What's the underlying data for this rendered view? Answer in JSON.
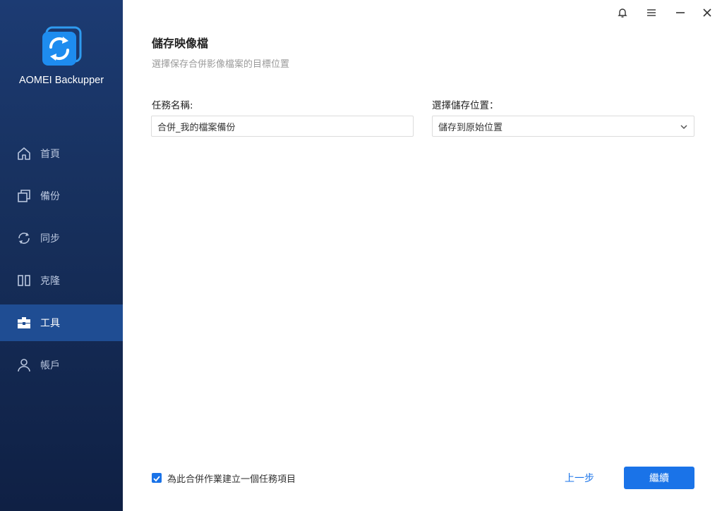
{
  "app": {
    "name": "AOMEI Backupper"
  },
  "sidebar": {
    "items": [
      {
        "label": "首頁",
        "icon": "home-icon"
      },
      {
        "label": "備份",
        "icon": "backup-icon"
      },
      {
        "label": "同步",
        "icon": "sync-icon"
      },
      {
        "label": "克隆",
        "icon": "clone-icon"
      },
      {
        "label": "工具",
        "icon": "toolbox-icon",
        "active": true
      },
      {
        "label": "帳戶",
        "icon": "user-icon"
      }
    ]
  },
  "window_controls": {
    "icons": [
      "bell-icon",
      "menu-icon",
      "minimize-icon",
      "close-icon"
    ]
  },
  "main": {
    "title": "儲存映像檔",
    "subtitle": "選擇保存合併影像檔案的目標位置",
    "task_name": {
      "label": "任務名稱:",
      "value": "合併_我的檔案備份"
    },
    "location": {
      "label": "選擇儲存位置：",
      "selected": "儲存到原始位置"
    }
  },
  "footer": {
    "checkbox_label": "為此合併作業建立一個任務項目",
    "checkbox_checked": true,
    "back_label": "上一步",
    "next_label": "繼續"
  },
  "colors": {
    "accent": "#1a73e8",
    "sidebar": "#17305d",
    "sidebar_active": "#1f4d93"
  }
}
